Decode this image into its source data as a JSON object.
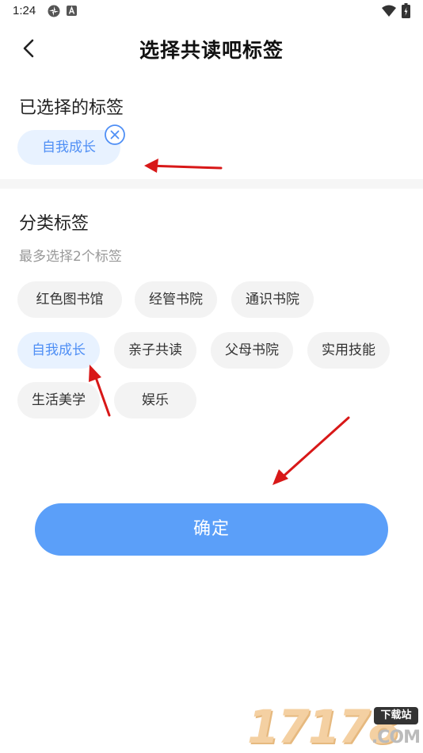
{
  "status_bar": {
    "time": "1:24",
    "icons": [
      "app-notification-icon",
      "text-notification-icon",
      "wifi-icon",
      "battery-icon"
    ]
  },
  "header": {
    "title": "选择共读吧标签",
    "back_icon": "chevron-left-icon"
  },
  "selected_section": {
    "heading": "已选择的标签",
    "tags": [
      {
        "label": "自我成长",
        "remove_icon": "close-circle-icon"
      }
    ]
  },
  "category_section": {
    "heading": "分类标签",
    "hint": "最多选择2个标签",
    "tags": [
      {
        "label": "红色图书馆",
        "selected": false
      },
      {
        "label": "经管书院",
        "selected": false
      },
      {
        "label": "通识书院",
        "selected": false
      },
      {
        "label": "自我成长",
        "selected": true
      },
      {
        "label": "亲子共读",
        "selected": false
      },
      {
        "label": "父母书院",
        "selected": false
      },
      {
        "label": "实用技能",
        "selected": false
      },
      {
        "label": "生活美学",
        "selected": false
      },
      {
        "label": "娱乐",
        "selected": false
      }
    ]
  },
  "confirm_button": {
    "label": "确定"
  },
  "watermark": {
    "digits": "17178",
    "badge": "下载站",
    "domain": ".COM"
  },
  "colors": {
    "accent": "#5b9ff9",
    "selected_tag_bg": "#e8f2ff",
    "selected_tag_text": "#4f8ff5",
    "tag_bg": "#f3f3f3",
    "annotation_arrow": "#e02020"
  }
}
